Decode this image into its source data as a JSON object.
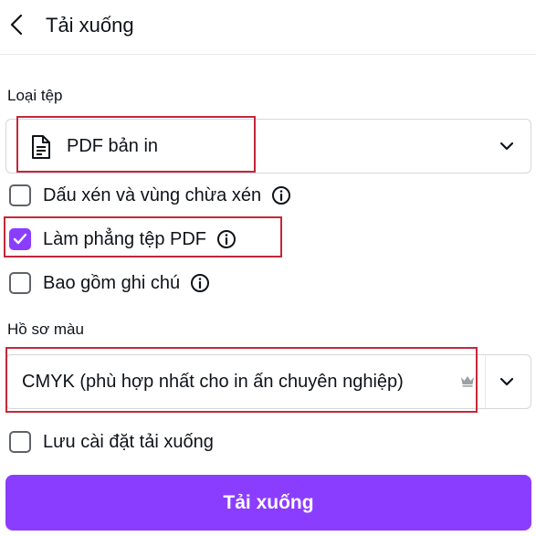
{
  "header": {
    "title": "Tải xuống",
    "back_icon": "chevron-left-icon"
  },
  "file_type": {
    "label": "Loại tệp",
    "selected": "PDF bản in",
    "icon": "document-icon"
  },
  "options": [
    {
      "label": "Dấu xén và vùng chừa xén",
      "checked": false
    },
    {
      "label": "Làm phẳng tệp PDF",
      "checked": true
    },
    {
      "label": "Bao gồm ghi chú",
      "checked": false
    }
  ],
  "color_profile": {
    "label": "Hồ sơ màu",
    "selected": "CMYK (phù hợp nhất cho in ấn chuyên nghiệp)",
    "premium_icon": "crown-icon"
  },
  "save_settings": {
    "label": "Lưu cài đặt tải xuống",
    "checked": false
  },
  "download_button": {
    "label": "Tải xuống"
  },
  "colors": {
    "accent": "#8b3dff",
    "highlight": "#c4283a"
  }
}
